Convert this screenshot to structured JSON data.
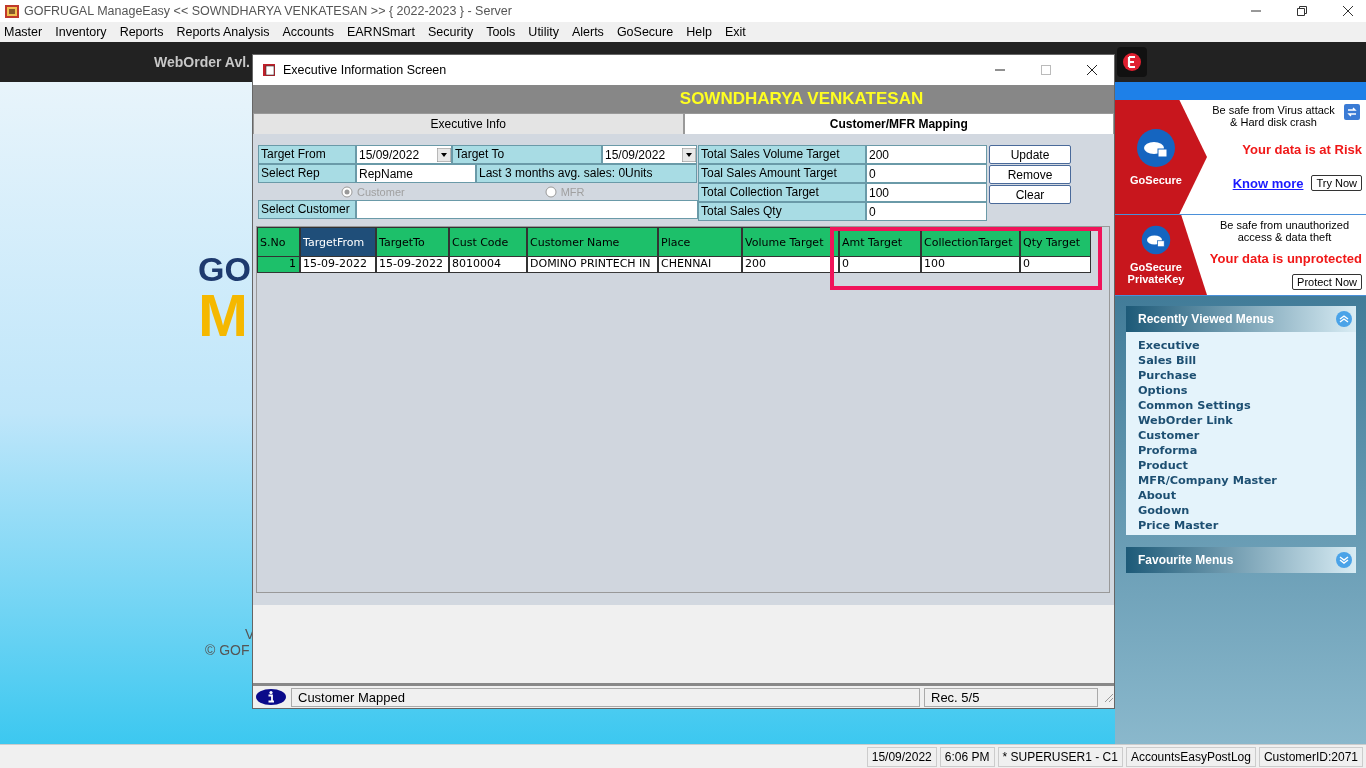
{
  "app_title": "GOFRUGAL ManageEasy << SOWNDHARYA VENKATESAN >> { 2022-2023 } - Server",
  "menu": [
    "Master",
    "Inventory",
    "Reports",
    "Reports Analysis",
    "Accounts",
    "EARNSmart",
    "Security",
    "Tools",
    "Utility",
    "Alerts",
    "GoSecure",
    "Help",
    "Exit"
  ],
  "toolbar": {
    "label": "WebOrder Avl."
  },
  "desktop": {
    "logo_top": "GO",
    "logo_bottom": "M",
    "line_1": "V",
    "copyright": "© GOF"
  },
  "dialog": {
    "title": "Executive Information Screen",
    "executive_name": "SOWNDHARYA VENKATESAN",
    "tabs": [
      {
        "label": "Executive Info",
        "selected": false
      },
      {
        "label": "Customer/MFR Mapping",
        "selected": true
      }
    ],
    "target_from": {
      "label": "Target From",
      "value": "15/09/2022"
    },
    "target_to": {
      "label": "Target To",
      "value": "15/09/2022"
    },
    "select_rep": {
      "label": "Select Rep",
      "value": "RepName"
    },
    "avg_sales": "Last 3 months avg. sales: 0Units",
    "mode_options": [
      {
        "label": "Customer",
        "selected": true,
        "disabled": true
      },
      {
        "label": "MFR",
        "selected": false,
        "disabled": true
      }
    ],
    "select_customer": {
      "label": "Select Customer"
    },
    "totals": [
      {
        "label": "Total Sales Volume Target",
        "value": "200"
      },
      {
        "label": "Toal Sales Amount Target",
        "value": "0"
      },
      {
        "label": "Total Collection Target",
        "value": "100"
      },
      {
        "label": "Total Sales Qty",
        "value": "0"
      }
    ],
    "buttons": [
      "Update",
      "Remove",
      "Clear"
    ],
    "table": {
      "columns": [
        {
          "label": "S.No",
          "selected": false
        },
        {
          "label": "TargetFrom",
          "selected": true
        },
        {
          "label": "TargetTo",
          "selected": false
        },
        {
          "label": "Cust Code",
          "selected": false
        },
        {
          "label": "Customer Name",
          "selected": false
        },
        {
          "label": "Place",
          "selected": false
        },
        {
          "label": "Volume Target",
          "selected": false
        },
        {
          "label": "Amt Target",
          "selected": false
        },
        {
          "label": "CollectionTarget",
          "selected": false
        },
        {
          "label": "Qty Target",
          "selected": false
        }
      ],
      "rows": [
        [
          "1",
          "15-09-2022",
          "15-09-2022",
          "8010004",
          "DOMINO PRINTECH IN",
          "CHENNAI",
          "200",
          "0",
          "100",
          "0"
        ]
      ]
    },
    "status_message": "Customer Mapped",
    "record_count": "Rec. 5/5"
  },
  "side_panel": {
    "ads": [
      {
        "brand": "GoSecure",
        "line": "Be safe from Virus attack & Hard disk crash",
        "alert": "Your data is at Risk",
        "link": "Know more",
        "button": "Try Now"
      },
      {
        "brand": "GoSecure PrivateKey",
        "line": "Be safe from unauthorized access & data theft",
        "alert": "Your data is unprotected",
        "button": "Protect Now"
      }
    ],
    "recent": {
      "title": "Recently Viewed Menus",
      "expanded": true,
      "items": [
        "Executive",
        "Sales Bill",
        "Purchase",
        "Options",
        "Common Settings",
        "WebOrder Link",
        "Customer",
        "Proforma",
        "Product",
        "MFR/Company Master",
        "About",
        "Godown",
        "Price Master"
      ]
    },
    "favourite": {
      "title": "Favourite Menus",
      "expanded": false
    }
  },
  "status_bar": [
    "15/09/2022",
    "6:06 PM",
    "* SUPERUSER1 - C1",
    "AccountsEasyPostLog",
    "CustomerID:2071"
  ]
}
